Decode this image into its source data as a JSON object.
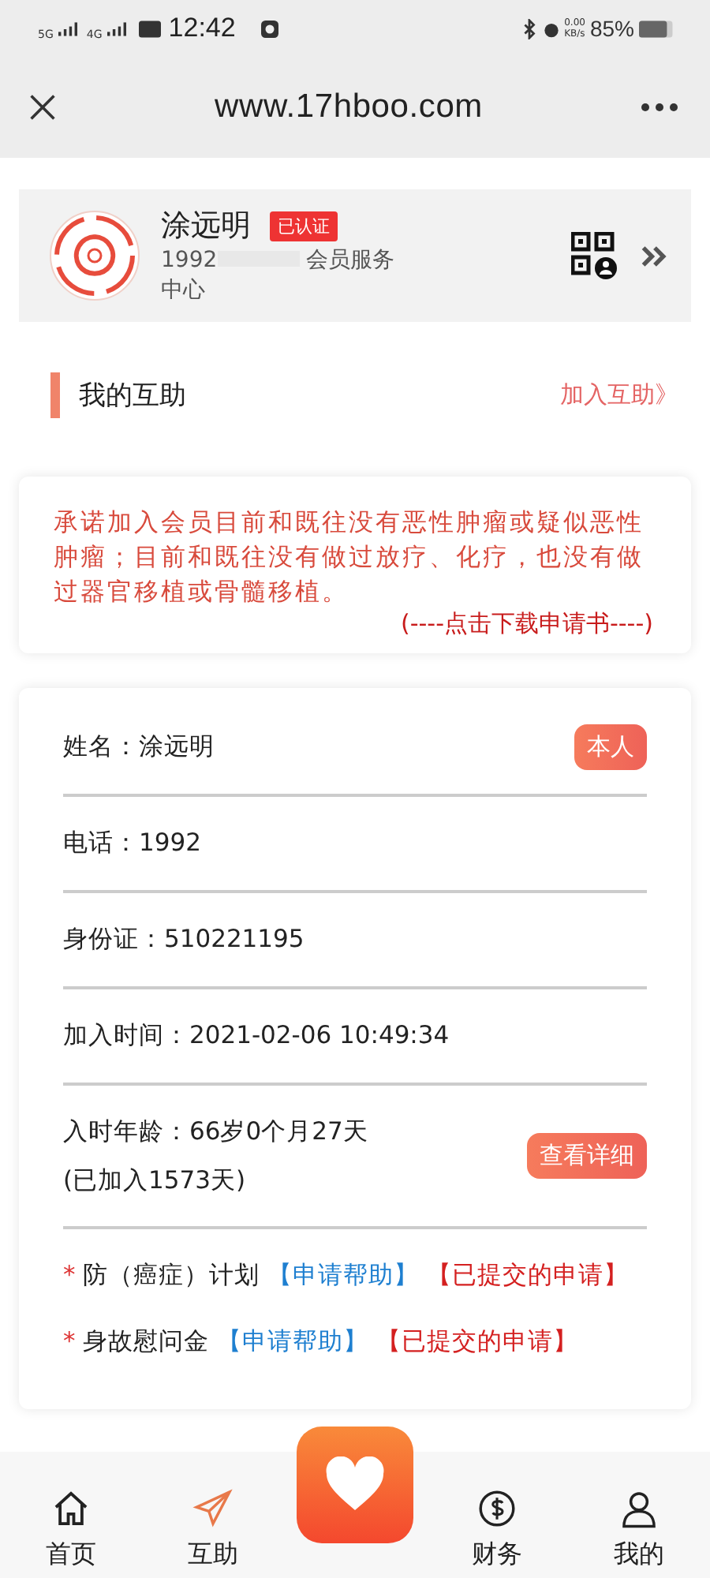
{
  "status_bar": {
    "network_1": "5G",
    "network_2": "4G",
    "time": "12:42",
    "speed": "0.00",
    "speed_unit": "KB/s",
    "battery": "85%"
  },
  "browser": {
    "title": "www.17hboo.com"
  },
  "profile": {
    "name": "涂远明",
    "badge": "已认证",
    "phone": "1992",
    "role": "会员服务中心"
  },
  "section": {
    "title": "我的互助",
    "link": "加入互助》"
  },
  "notice": {
    "text": "承诺加入会员目前和既往没有恶性肿瘤或疑似恶性肿瘤；目前和既往没有做过放疗、化疗，也没有做过器官移植或骨髓移植。",
    "link": "(----点击下载申请书----)"
  },
  "member": {
    "fields": [
      {
        "label": "姓名：",
        "value": "涂远明",
        "button": "本人"
      },
      {
        "label": "电话：",
        "value": "1992"
      },
      {
        "label": "身份证：",
        "value": "510221195"
      },
      {
        "label": "加入时间：",
        "value": "2021-02-06 10:49:34"
      },
      {
        "label": "入时年龄：",
        "value": "66岁0个月27天",
        "note": "(已加入1573天)",
        "button": "查看详细"
      }
    ],
    "plans": [
      {
        "mark": "*",
        "name": "防（癌症）计划",
        "apply": "【申请帮助】",
        "submitted": "【已提交的申请】"
      },
      {
        "mark": "*",
        "name": "身故慰问金",
        "apply": "【申请帮助】",
        "submitted": "【已提交的申请】"
      }
    ]
  },
  "tabs": [
    {
      "label": "首页",
      "kind": "home",
      "selected": false
    },
    {
      "label": "互助",
      "kind": "send",
      "selected": true
    },
    {
      "kind": "action",
      "selected": false
    },
    {
      "label": "财务",
      "kind": "money",
      "selected": false
    },
    {
      "label": "我的",
      "kind": "user",
      "selected": false
    }
  ]
}
